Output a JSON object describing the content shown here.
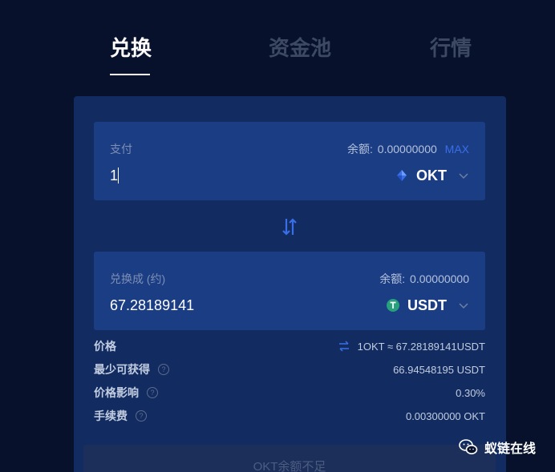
{
  "tabs": [
    {
      "label": "兑换",
      "active": true
    },
    {
      "label": "资金池",
      "active": false
    },
    {
      "label": "行情",
      "active": false
    }
  ],
  "pay": {
    "label": "支付",
    "balance_prefix": "余额:",
    "balance_value": "0.00000000",
    "max_label": "MAX",
    "amount": "1",
    "token": "OKT",
    "token_icon": "okt-token-icon"
  },
  "receive": {
    "label": "兑换成 (约)",
    "balance_prefix": "余额:",
    "balance_value": "0.00000000",
    "amount": "67.28189141",
    "token": "USDT",
    "token_icon": "usdt-token-icon"
  },
  "info": {
    "price_label": "价格",
    "price_value": "1OKT ≈ 67.28189141USDT",
    "min_received_label": "最少可获得",
    "min_received_value": "66.94548195 USDT",
    "price_impact_label": "价格影响",
    "price_impact_value": "0.30%",
    "fee_label": "手续费",
    "fee_value": "0.00300000 OKT"
  },
  "submit_label": "OKT余额不足",
  "watermark": "蚁链在线",
  "colors": {
    "background": "#07112b",
    "card": "#122c61",
    "input_box": "#1a3d84",
    "accent": "#3a6ee8",
    "usdt_green": "#26a17b"
  }
}
